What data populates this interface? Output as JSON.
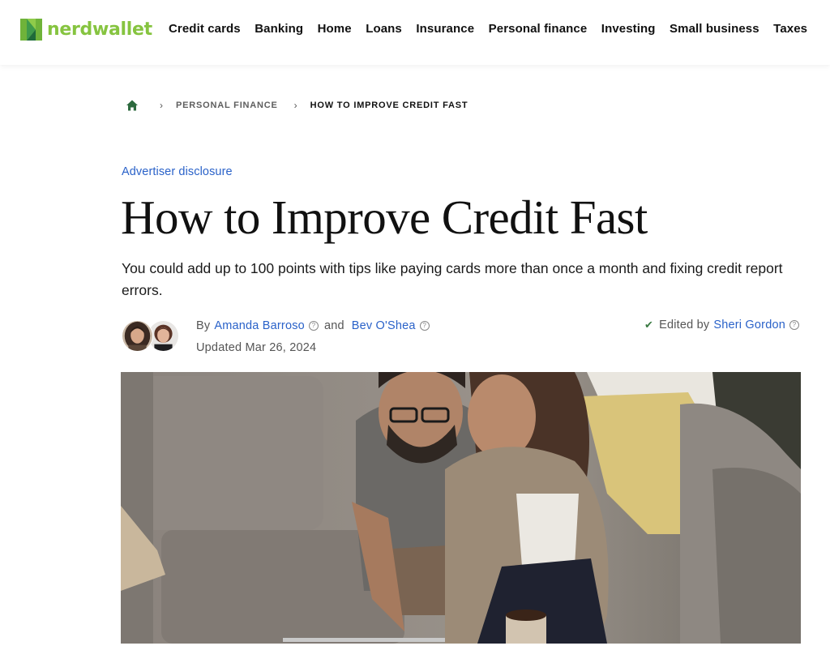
{
  "header": {
    "logo_text": "nerdwallet",
    "brand_color": "#86c440",
    "nav": [
      {
        "label": "Credit cards"
      },
      {
        "label": "Banking"
      },
      {
        "label": "Home"
      },
      {
        "label": "Loans"
      },
      {
        "label": "Insurance"
      },
      {
        "label": "Personal finance"
      },
      {
        "label": "Investing"
      },
      {
        "label": "Small business"
      },
      {
        "label": "Taxes"
      }
    ]
  },
  "breadcrumb": {
    "home_icon": "home-icon",
    "separator": "›",
    "items": [
      {
        "label": "PERSONAL FINANCE"
      },
      {
        "label": "HOW TO IMPROVE CREDIT FAST"
      }
    ]
  },
  "article": {
    "advertiser_disclosure": "Advertiser disclosure",
    "title": "How to Improve Credit Fast",
    "dek": "You could add up to 100 points with tips like paying cards more than once a month and fixing credit report errors.",
    "byline": {
      "by_label": "By",
      "authors": [
        {
          "name": "Amanda Barroso"
        },
        {
          "name": "Bev O'Shea"
        }
      ],
      "and_label": "and",
      "help_glyph": "?",
      "updated": "Updated Mar 26, 2024",
      "edited_by_label": "Edited by",
      "editor": "Sheri Gordon",
      "check_glyph": "✔"
    },
    "hero_image_alt": "Couple on a sofa looking at a tablet"
  },
  "colors": {
    "link": "#2a62c9",
    "home_icon": "#2d6a3e",
    "check": "#3a7a42"
  }
}
